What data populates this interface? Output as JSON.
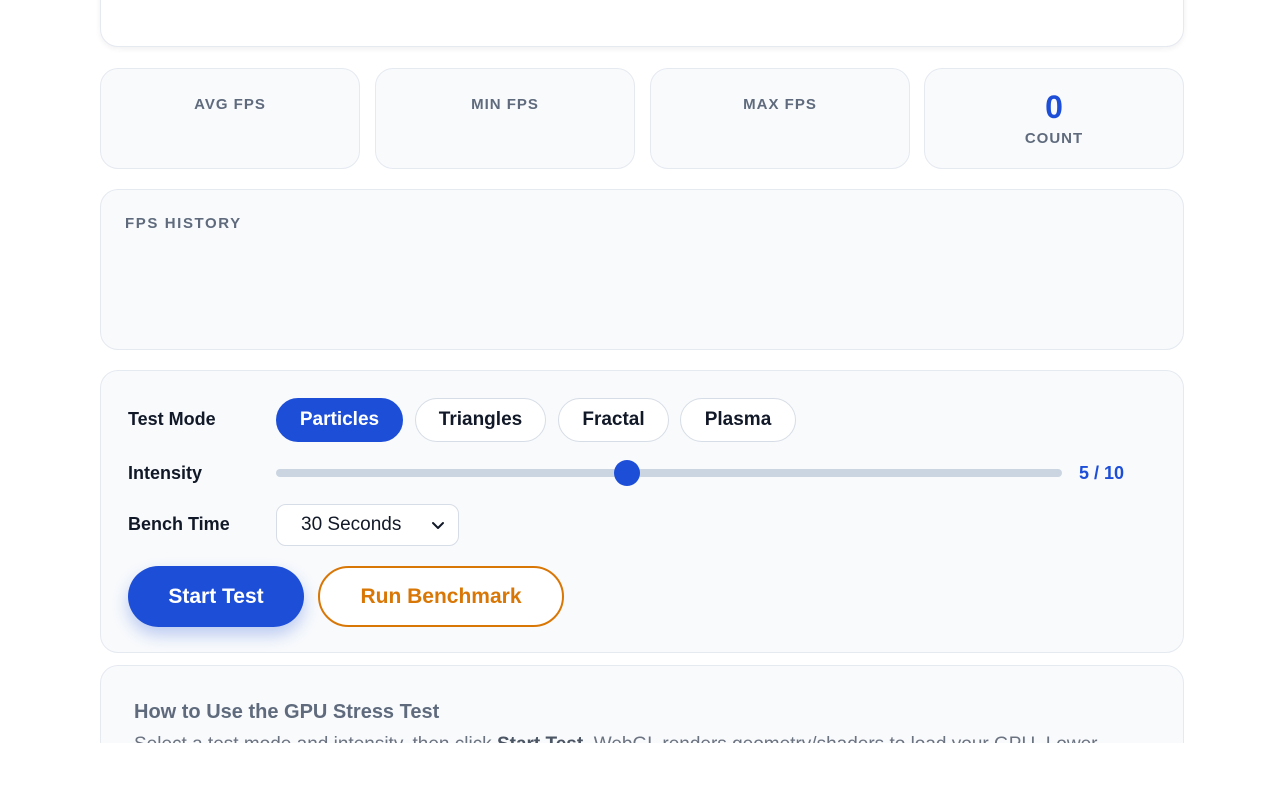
{
  "stats": {
    "avg_label": "AVG FPS",
    "min_label": "MIN FPS",
    "max_label": "MAX FPS",
    "count_value": "0",
    "count_label": "COUNT"
  },
  "history": {
    "title": "FPS HISTORY"
  },
  "controls": {
    "test_mode_label": "Test Mode",
    "modes": [
      "Particles",
      "Triangles",
      "Fractal",
      "Plasma"
    ],
    "active_mode": "Particles",
    "intensity_label": "Intensity",
    "intensity_value": 5,
    "intensity_max": 10,
    "intensity_text": "5 / 10",
    "bench_time_label": "Bench Time",
    "bench_time_value": "30 Seconds",
    "start_button": "Start Test",
    "benchmark_button": "Run Benchmark"
  },
  "howto": {
    "title": "How to Use the GPU Stress Test",
    "text_before": "Select a test mode and intensity, then click ",
    "text_bold": "Start Test",
    "text_after": ". WebGL renders geometry/shaders to load your GPU. Lower"
  },
  "colors": {
    "accent": "#1d4ed8",
    "benchmark_accent": "#d97706",
    "label_gray": "#5f6b7d",
    "card_bg": "#f8fafc"
  }
}
